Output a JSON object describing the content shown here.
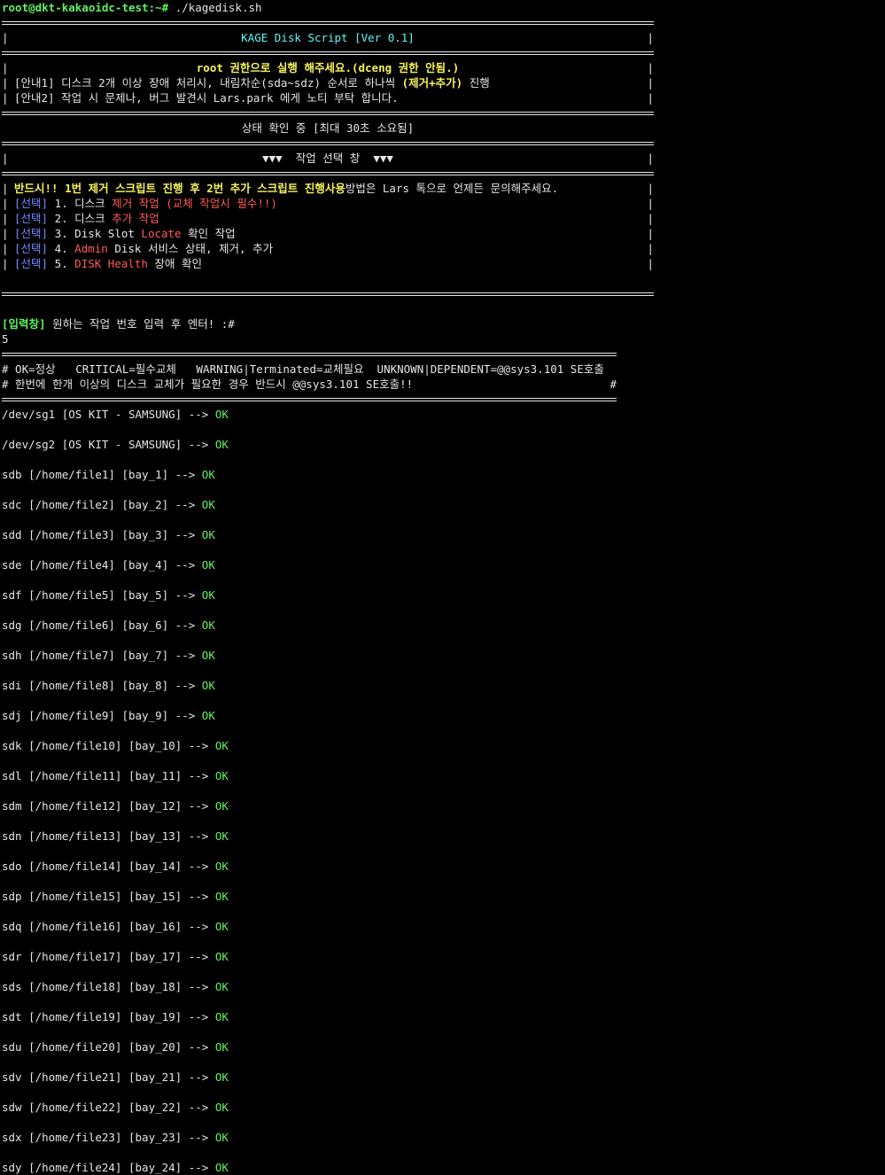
{
  "prompt": "root@dkt-kakaoidc-test:~#",
  "command": " ./kagedisk.sh",
  "header": {
    "title": "KAGE Disk Script [Ver 0.1]"
  },
  "notice": {
    "root_warning": "root 권한으로 실행 해주세요.(dceng 권한 안됨.)",
    "info1_prefix": "[안내1] 디스크 2개 이상 장애 처리시, 내림차순(sda~sdz) 순서로 하나씩 ",
    "info1_highlight": "(제거+추가)",
    "info1_suffix": " 진행",
    "info2": "[안내2] 작업 시 문제나, 버그 발견시 Lars.park 에게 노티 부탁 합니다."
  },
  "status_check": "상태 확인 중 [최대 30초 소요됨]",
  "menu_title": "▼▼▼  작업 선택 창  ▼▼▼",
  "menu": {
    "must_note": "반드시!! 1번 제거 스크립트 진행 후 2번 추가 스크립트 진행",
    "usage_label": "사용",
    "usage_text": "방법은 Lars 톡으로 언제든 문의해주세요.",
    "tag": "[선택]",
    "opt1_a": " 1. 디스크 ",
    "opt1_red": "제거 작업 (교체 작업시 필수!!)",
    "opt2_a": " 2. 디스크 ",
    "opt2_red": "추가 작업",
    "opt3_a": " 3. Disk Slot ",
    "opt3_red": "Locate",
    "opt3_b": " 확인 작업",
    "opt4_a": " 4. ",
    "opt4_red": "Admin",
    "opt4_b": " Disk 서비스 상태, 제거, 추가",
    "opt5_a": " 5. ",
    "opt5_red": "DISK Health",
    "opt5_b": " 장애 확인"
  },
  "input": {
    "label": "[입력창]",
    "text": " 원하는 작업 번호 입력 후 엔터! :#",
    "value": "5"
  },
  "legend": {
    "line1": "# OK=정상   CRITICAL=필수교체   WARNING|Terminated=교체필요  UNKNOWN|DEPENDENT=@@sys3.101 SE호출  #",
    "line2": "# 한번에 한개 이상의 디스크 교체가 필요한 경우 반드시 @@sys3.101 SE호출!!",
    "line2_end": "#"
  },
  "arrow": " --> ",
  "disks": [
    {
      "dev": "/dev/sg1 [OS KIT - SAMSUNG]",
      "status": "OK"
    },
    {
      "dev": "/dev/sg2 [OS KIT - SAMSUNG]",
      "status": "OK"
    },
    {
      "dev": "sdb [/home/file1] [bay_1]",
      "status": "OK"
    },
    {
      "dev": "sdc [/home/file2] [bay_2]",
      "status": "OK"
    },
    {
      "dev": "sdd [/home/file3] [bay_3]",
      "status": "OK"
    },
    {
      "dev": "sde [/home/file4] [bay_4]",
      "status": "OK"
    },
    {
      "dev": "sdf [/home/file5] [bay_5]",
      "status": "OK"
    },
    {
      "dev": "sdg [/home/file6] [bay_6]",
      "status": "OK"
    },
    {
      "dev": "sdh [/home/file7] [bay_7]",
      "status": "OK"
    },
    {
      "dev": "sdi [/home/file8] [bay_8]",
      "status": "OK"
    },
    {
      "dev": "sdj [/home/file9] [bay_9]",
      "status": "OK"
    },
    {
      "dev": "sdk [/home/file10] [bay_10]",
      "status": "OK"
    },
    {
      "dev": "sdl [/home/file11] [bay_11]",
      "status": "OK"
    },
    {
      "dev": "sdm [/home/file12] [bay_12]",
      "status": "OK"
    },
    {
      "dev": "sdn [/home/file13] [bay_13]",
      "status": "OK"
    },
    {
      "dev": "sdo [/home/file14] [bay_14]",
      "status": "OK"
    },
    {
      "dev": "sdp [/home/file15] [bay_15]",
      "status": "OK"
    },
    {
      "dev": "sdq [/home/file16] [bay_16]",
      "status": "OK"
    },
    {
      "dev": "sdr [/home/file17] [bay_17]",
      "status": "OK"
    },
    {
      "dev": "sds [/home/file18] [bay_18]",
      "status": "OK"
    },
    {
      "dev": "sdt [/home/file19] [bay_19]",
      "status": "OK"
    },
    {
      "dev": "sdu [/home/file20] [bay_20]",
      "status": "OK"
    },
    {
      "dev": "sdv [/home/file21] [bay_21]",
      "status": "OK"
    },
    {
      "dev": "sdw [/home/file22] [bay_22]",
      "status": "OK"
    },
    {
      "dev": "sdx [/home/file23] [bay_23]",
      "status": "OK"
    },
    {
      "dev": "sdy [/home/file24] [bay_24]",
      "status": "OK"
    }
  ]
}
